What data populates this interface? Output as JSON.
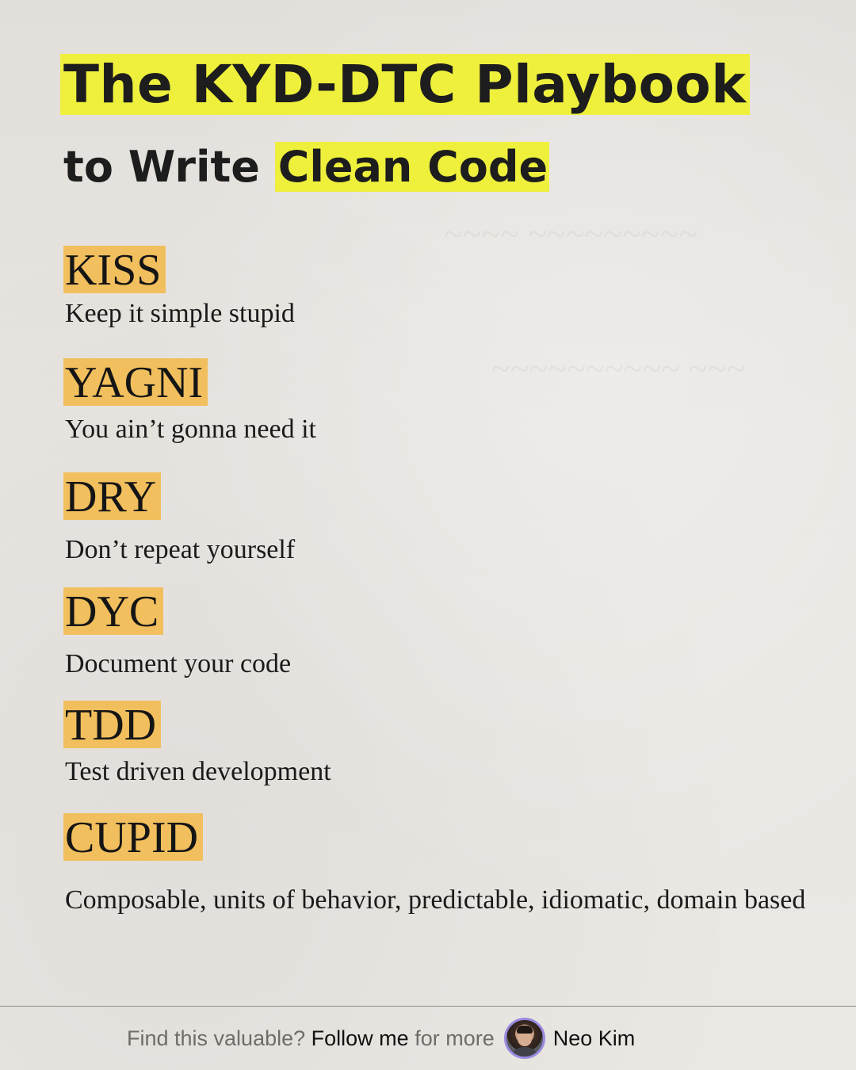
{
  "title": {
    "line1": "The KYD-DTC Playbook",
    "line2_prefix": "to Write",
    "line2_highlight": "Clean Code"
  },
  "principles": [
    {
      "acronym": "KISS",
      "meaning": "Keep it simple stupid"
    },
    {
      "acronym": "YAGNI",
      "meaning": "You ain’t gonna need it"
    },
    {
      "acronym": "DRY",
      "meaning": "Don’t repeat yourself"
    },
    {
      "acronym": "DYC",
      "meaning": "Document your code"
    },
    {
      "acronym": "TDD",
      "meaning": "Test driven development"
    },
    {
      "acronym": "CUPID",
      "meaning": "Composable, units of behavior, predictable, idiomatic, domain based"
    }
  ],
  "footer": {
    "prompt": "Find this valuable?",
    "cta": "Follow me",
    "suffix": "for more",
    "author": "Neo Kim"
  },
  "colors": {
    "title_highlight": "#eef03c",
    "acronym_highlight": "#f1bf5d",
    "avatar_ring": "#9b8be0"
  }
}
